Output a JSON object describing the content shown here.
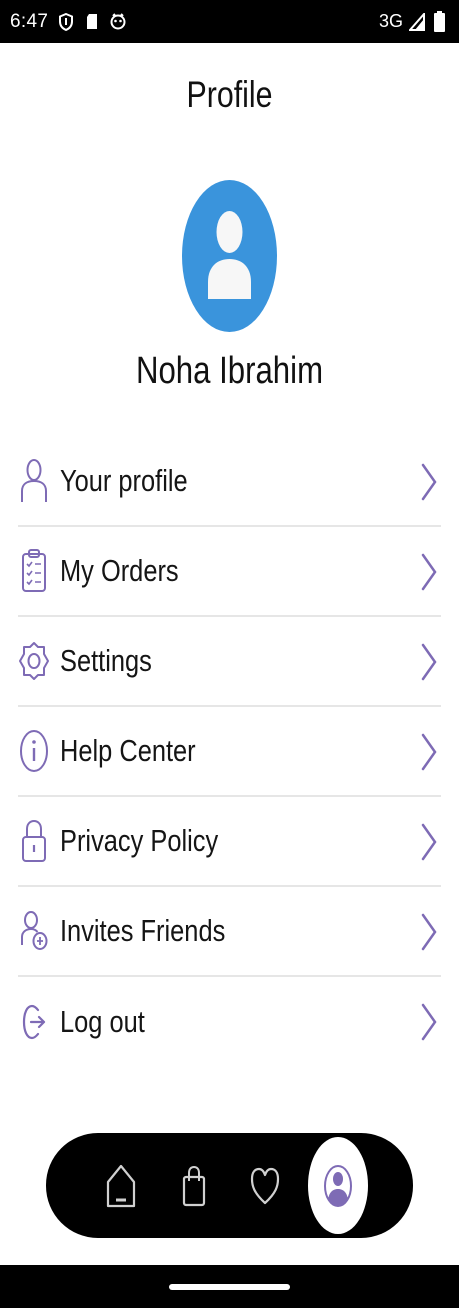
{
  "status_bar": {
    "time": "6:47",
    "network": "3G",
    "icons": [
      "shield-icon",
      "sd-card-icon",
      "notification-icon",
      "signal-icon",
      "battery-icon"
    ]
  },
  "header": {
    "title": "Profile"
  },
  "profile": {
    "name": "Noha Ibrahim",
    "avatar_icon": "user-avatar-icon"
  },
  "menu": {
    "items": [
      {
        "label": "Your profile",
        "icon": "person-icon"
      },
      {
        "label": "My Orders",
        "icon": "clipboard-icon"
      },
      {
        "label": "Settings",
        "icon": "gear-icon"
      },
      {
        "label": "Help Center",
        "icon": "info-icon"
      },
      {
        "label": "Privacy Policy",
        "icon": "lock-icon"
      },
      {
        "label": "Invites Friends",
        "icon": "add-friend-icon"
      },
      {
        "label": "Log out",
        "icon": "logout-icon"
      }
    ]
  },
  "bottom_nav": {
    "items": [
      {
        "icon": "home-icon",
        "active": false
      },
      {
        "icon": "shopping-bag-icon",
        "active": false
      },
      {
        "icon": "heart-icon",
        "active": false
      },
      {
        "icon": "profile-icon",
        "active": true
      }
    ]
  },
  "colors": {
    "accent": "#7e6bb5",
    "avatar_bg": "#3a94dc",
    "nav_bg": "#000000",
    "divider": "#e6e6e6"
  }
}
